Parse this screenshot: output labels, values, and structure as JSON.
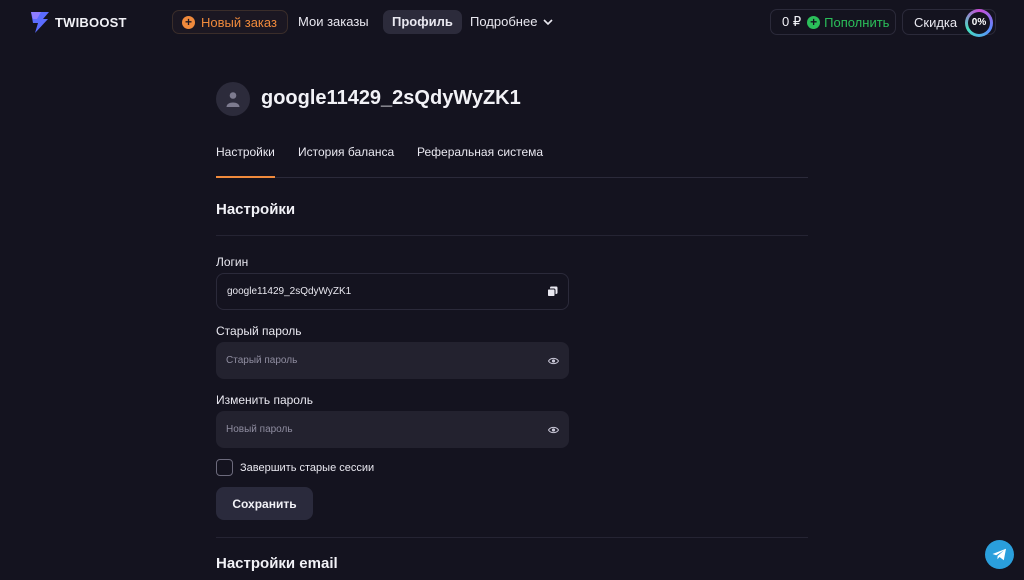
{
  "header": {
    "logo_text": "TWIBOOST",
    "new_order_label": "Новый заказ",
    "nav": {
      "orders": "Мои заказы",
      "profile": "Профиль",
      "more": "Подробнее"
    },
    "balance": "0 ₽",
    "topup_label": "Пополнить",
    "discount_label": "Скидка",
    "discount_value": "0%"
  },
  "profile": {
    "username": "google11429_2sQdyWyZK1"
  },
  "tabs": {
    "settings": "Настройки",
    "history": "История баланса",
    "referral": "Реферальная система"
  },
  "settings": {
    "title": "Настройки",
    "login_label": "Логин",
    "login_value": "google11429_2sQdyWyZK1",
    "old_password_label": "Старый пароль",
    "old_password_placeholder": "Старый пароль",
    "new_password_label": "Изменить пароль",
    "new_password_placeholder": "Новый пароль",
    "end_sessions_label": "Завершить старые сессии",
    "save_label": "Сохранить"
  },
  "email_settings": {
    "title": "Настройки email"
  },
  "colors": {
    "background": "#14131f",
    "accent_orange": "#f08a3c",
    "accent_green": "#2bbf5a",
    "telegram_blue": "#2a9fdc"
  },
  "icons": {
    "logo": "lightning-icon",
    "new_order": "plus-circle-icon",
    "more": "chevron-down-icon",
    "topup": "plus-circle-icon",
    "avatar": "user-icon",
    "copy": "copy-icon",
    "eye": "eye-icon",
    "telegram": "telegram-icon"
  }
}
